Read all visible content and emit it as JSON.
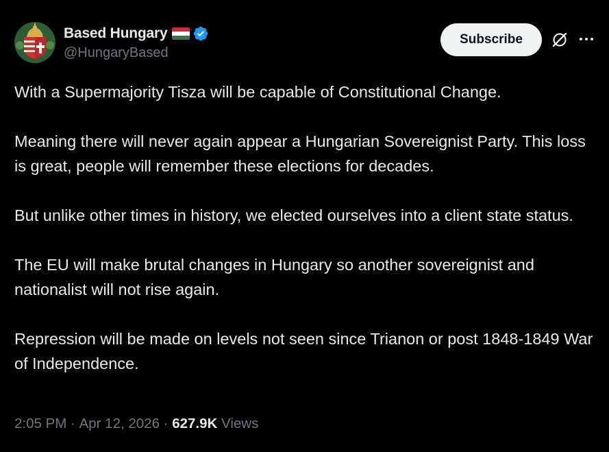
{
  "author": {
    "display_name": "Based Hungary",
    "handle": "@HungaryBased",
    "flag_icon": "hungary-flag-icon",
    "verified_icon": "verified-badge-icon",
    "verified_color": "#1d9bf0"
  },
  "actions": {
    "subscribe_label": "Subscribe",
    "grok_icon": "grok-icon",
    "more_icon": "more-icon"
  },
  "post": {
    "paragraphs": [
      "With a Supermajority Tisza will be capable of Constitutional Change.",
      "Meaning there will never again appear a Hungarian Sovereignist Party. This loss is great, people will remember these elections for decades.",
      "But unlike other times in history, we elected ourselves into a client state status.",
      "The EU will make brutal changes in Hungary so another sovereignist and nationalist will not rise again.",
      "Repression will be made on levels not seen since Trianon or post 1848-1849 War of Independence."
    ]
  },
  "meta": {
    "time": "2:05 PM",
    "separator": " · ",
    "date": "Apr 12, 2026",
    "views_count": "627.9K",
    "views_label": "Views"
  },
  "colors": {
    "background": "#000000",
    "text_primary": "#e7e9ea",
    "text_secondary": "#71767b",
    "button_bg": "#eff3f4",
    "flag_red": "#cd2a3e",
    "flag_white": "#ffffff",
    "flag_green": "#436f4d"
  }
}
